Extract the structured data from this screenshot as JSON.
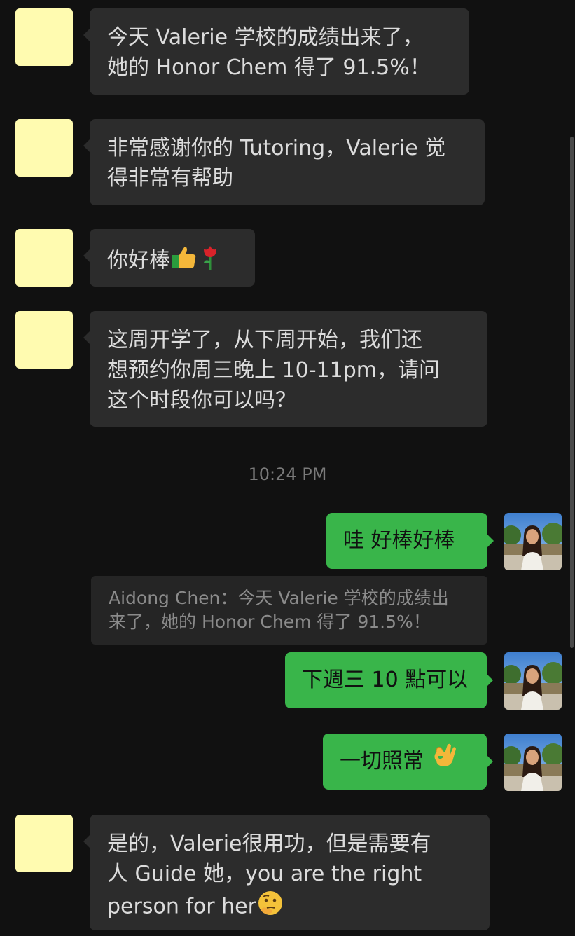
{
  "messages": {
    "m1": {
      "line1": "今天 Valerie 学校的成绩出来了，",
      "line2": "她的 Honor Chem 得了 91.5%！"
    },
    "m2": {
      "line1": "非常感谢你的 Tutoring，Valerie 觉",
      "line2": "得非常有帮助"
    },
    "m3": {
      "text": "你好棒",
      "emoji1": "thumbs-up-icon",
      "emoji2": "rose-icon"
    },
    "m4": {
      "line1": "这周开学了，从下周开始，我们还",
      "line2": "想预约你周三晚上 10-11pm，请问",
      "line3": "这个时段你可以吗？"
    },
    "m5": {
      "text": "哇 好棒好棒"
    },
    "m6": {
      "text": "下週三 10 點可以"
    },
    "m7": {
      "text": "一切照常",
      "emoji": "ok-hand-icon"
    },
    "m8": {
      "line1": "是的，Valerie很用功，但是需要有",
      "line2": "人 Guide 她，you are the right",
      "line3": "person for her",
      "emoji": "thinking-face-icon"
    }
  },
  "timestamp": "10:24 PM",
  "quote": {
    "line1": "Aidong Chen：今天 Valerie 学校的成绩出",
    "line2": "来了，她的 Honor Chem 得了 91.5%！"
  },
  "colors": {
    "background": "#111111",
    "incoming_bubble": "#2c2c2c",
    "outgoing_bubble": "#39b54a",
    "placeholder_avatar": "#fffbb0"
  }
}
